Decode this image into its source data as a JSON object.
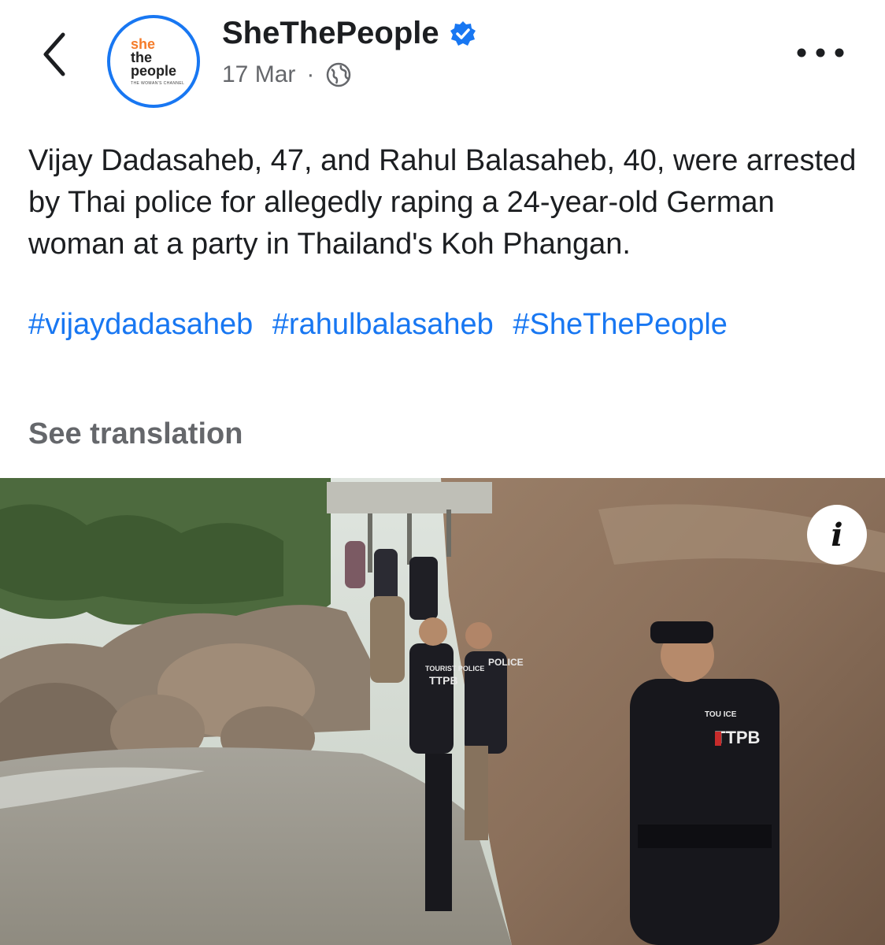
{
  "header": {
    "page_name": "SheThePeople",
    "verified_icon": "verified-badge-icon",
    "date": "17 Mar",
    "separator": "·",
    "audience_icon": "globe-icon",
    "more_icon": "more-options-icon",
    "back_icon": "back-chevron-icon"
  },
  "avatar": {
    "line1": "she",
    "line2": "the",
    "line3": "people",
    "tagline": "THE WOMAN'S CHANNEL"
  },
  "post": {
    "text": "Vijay Dadasaheb, 47, and Rahul Balasaheb, 40, were arrested by Thai police for allegedly raping a 24-year-old German woman at a party in Thailand's Koh Phangan.",
    "hashtags": [
      "#vijaydadasaheb",
      "#rahulbalasaheb",
      "#SheThePeople"
    ],
    "see_translation": "See translation"
  },
  "photo": {
    "info_label": "i",
    "vest_text_1": "TOURIST POLICE",
    "vest_text_2": "TTPB",
    "vest_text_3": "POLICE",
    "vest_text_4": "TOU    ICE"
  },
  "colors": {
    "link": "#1877f2",
    "muted": "#65676b",
    "brand_orange": "#f57c2a"
  }
}
